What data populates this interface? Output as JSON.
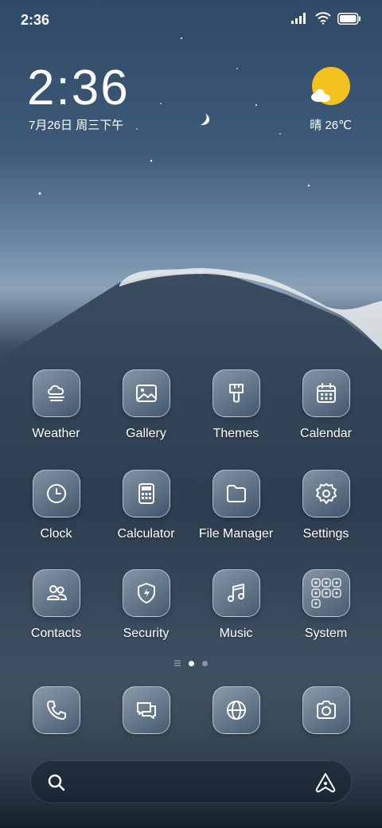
{
  "status_bar": {
    "time": "2:36"
  },
  "widget": {
    "clock": "2:36",
    "date": "7月26日 周三下午",
    "weather": "晴 26℃"
  },
  "apps": [
    {
      "label": "Weather",
      "icon": "cloud-fog-icon"
    },
    {
      "label": "Gallery",
      "icon": "image-icon"
    },
    {
      "label": "Themes",
      "icon": "paintbrush-icon"
    },
    {
      "label": "Calendar",
      "icon": "calendar-icon"
    },
    {
      "label": "Clock",
      "icon": "clock-icon"
    },
    {
      "label": "Calculator",
      "icon": "calculator-icon"
    },
    {
      "label": "File Manager",
      "icon": "folder-icon"
    },
    {
      "label": "Settings",
      "icon": "gear-icon"
    },
    {
      "label": "Contacts",
      "icon": "contacts-icon"
    },
    {
      "label": "Security",
      "icon": "shield-icon"
    },
    {
      "label": "Music",
      "icon": "music-note-icon"
    },
    {
      "label": "System",
      "icon": "folder-grid-icon"
    }
  ],
  "dock": [
    {
      "icon": "phone-icon"
    },
    {
      "icon": "messages-icon"
    },
    {
      "icon": "browser-icon"
    },
    {
      "icon": "camera-icon"
    }
  ],
  "page_indicator": {
    "pages": 2,
    "active": 0
  }
}
